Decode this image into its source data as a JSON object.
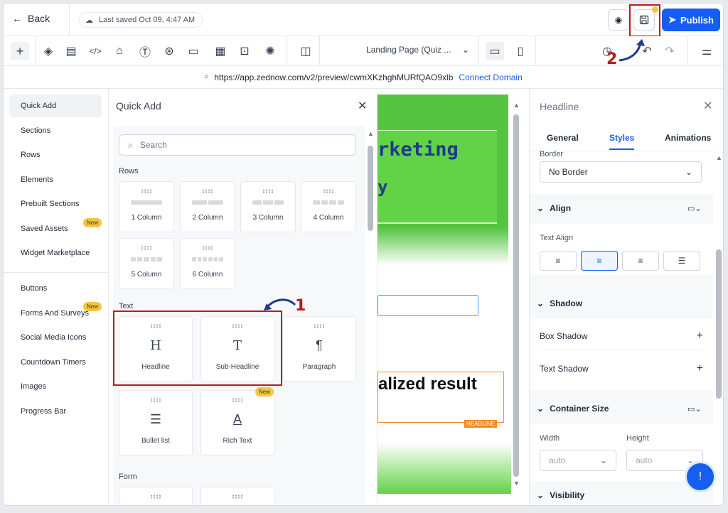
{
  "topbar": {
    "back_label": "Back",
    "saved_text": "Last saved Oct 09, 4:47 AM",
    "publish_label": "Publish",
    "preview_icon": "eye-icon",
    "save_icon": "floppy-disk-icon"
  },
  "toolbar": {
    "page_select": "Landing Page (Quiz ...",
    "icons": [
      "plus-icon",
      "layers-icon",
      "page-icon",
      "code-icon",
      "brush-icon",
      "text-icon",
      "shapes-icon",
      "layout-icon",
      "form-icon",
      "terminal-icon",
      "palette-icon",
      "columns-icon",
      "desktop-icon",
      "mobile-icon",
      "history-icon",
      "undo-icon",
      "redo-icon",
      "settings-sliders-icon"
    ]
  },
  "urlbar": {
    "url": "https://app.zednow.com/v2/preview/cwmXKzhghMURfQAO9xlb",
    "connect_label": "Connect Domain"
  },
  "leftnav": {
    "items": [
      {
        "label": "Quick Add"
      },
      {
        "label": "Sections"
      },
      {
        "label": "Rows"
      },
      {
        "label": "Elements"
      },
      {
        "label": "Prebuilt Sections"
      },
      {
        "label": "Saved Assets",
        "badge": "New"
      },
      {
        "label": "Widget Marketplace"
      },
      {
        "label": "Buttons"
      },
      {
        "label": "Forms And Surveys",
        "badge": "New"
      },
      {
        "label": "Social Media Icons"
      },
      {
        "label": "Countdown Timers"
      },
      {
        "label": "Images"
      },
      {
        "label": "Progress Bar"
      }
    ]
  },
  "quickadd": {
    "title": "Quick Add",
    "search_placeholder": "Search",
    "rows_label": "Rows",
    "rows": [
      "1 Column",
      "2 Column",
      "3 Column",
      "4 Column",
      "5 Column",
      "6 Column"
    ],
    "text_label": "Text",
    "text_items": [
      {
        "label": "Headline",
        "glyph": "H"
      },
      {
        "label": "Sub-Headline",
        "glyph": "T"
      },
      {
        "label": "Paragraph",
        "glyph": "¶"
      },
      {
        "label": "Bullet list",
        "glyph": "☰"
      },
      {
        "label": "Rich Text",
        "glyph": "A",
        "badge": "New"
      }
    ],
    "form_label": "Form"
  },
  "canvas": {
    "heading_fragment": "rketing",
    "subline_fragment": "y",
    "result_fragment": "alized result",
    "headline_tag": "HEADLINE"
  },
  "rightpanel": {
    "title": "Headline",
    "tabs": [
      "General",
      "Styles",
      "Animations"
    ],
    "active_tab": "Styles",
    "border_label": "Border",
    "border_value": "No Border",
    "align_section": "Align",
    "text_align_label": "Text Align",
    "shadow_section": "Shadow",
    "box_shadow": "Box Shadow",
    "text_shadow": "Text Shadow",
    "container_section": "Container Size",
    "width_label": "Width",
    "height_label": "Height",
    "width_value": "auto",
    "height_value": "auto",
    "visibility_section": "Visibility"
  },
  "annotations": {
    "step1": "1",
    "step2": "2"
  },
  "colors": {
    "accent": "#155eef",
    "highlight": "#b91c1c",
    "badge": "#f5c542",
    "canvas_green": "#55c440",
    "headline_orange": "#f08c24"
  }
}
